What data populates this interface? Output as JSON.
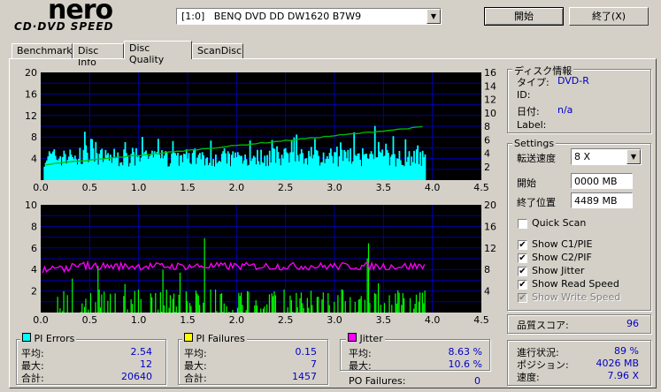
{
  "logo": {
    "line1": "nero",
    "line2": "CD·DVD SPEED"
  },
  "drive_select": {
    "value": "[1:0]   BENQ DVD DD DW1620 B7W9"
  },
  "buttons": {
    "start": "開始",
    "exit": "終了(X)"
  },
  "tabs": [
    {
      "label": "Benchmark"
    },
    {
      "label": "Disc Info"
    },
    {
      "label": "Disc Quality"
    },
    {
      "label": "ScanDisc"
    }
  ],
  "disc_info": {
    "title": "ディスク情報",
    "type_label": "タイプ:",
    "type_value": "DVD-R",
    "id_label": "ID:",
    "date_label": "日付:",
    "date_value": "n/a",
    "label_label": "Label:"
  },
  "settings": {
    "title": "Settings",
    "speed_label": "転送速度",
    "speed_value": "8 X",
    "start_label": "開始",
    "start_value": "0000 MB",
    "end_label": "終了位置",
    "end_value": "4489 MB",
    "quick_scan": "Quick Scan",
    "show_c1": "Show C1/PIE",
    "show_c2": "Show C2/PIF",
    "show_jitter": "Show Jitter",
    "show_read_speed": "Show Read Speed",
    "show_write_speed": "Show Write Speed"
  },
  "quality": {
    "label": "品質スコア:",
    "value": "96"
  },
  "progress": {
    "progress_label": "進行状況:",
    "progress_value": "89 %",
    "position_label": "ポジション:",
    "position_value": "4026 MB",
    "speed_label": "速度:",
    "speed_value": "7.96 X"
  },
  "pi_errors": {
    "title": "PI Errors",
    "avg_label": "平均:",
    "avg": "2.54",
    "max_label": "最大:",
    "max": "12",
    "total_label": "合計:",
    "total": "20640",
    "color": "#00ffff"
  },
  "pi_failures": {
    "title": "PI Failures",
    "avg_label": "平均:",
    "avg": "0.15",
    "max_label": "最大:",
    "max": "7",
    "total_label": "合計:",
    "total": "1457",
    "color": "#ffff00"
  },
  "jitter": {
    "title": "Jitter",
    "avg_label": "平均:",
    "avg": "8.63 %",
    "max_label": "最大:",
    "max": "10.6 %",
    "color": "#ff00ff"
  },
  "po_failures": {
    "label": "PO Failures:",
    "value": "0"
  },
  "chart_data": [
    {
      "type": "bar",
      "x_ticks": [
        "0.0",
        "0.5",
        "1.0",
        "1.5",
        "2.0",
        "2.5",
        "3.0",
        "3.5",
        "4.0",
        "4.5"
      ],
      "y_left_ticks": [
        "20",
        "16",
        "12",
        "8",
        "4"
      ],
      "y_right_ticks": [
        "16",
        "14",
        "12",
        "10",
        "8",
        "6",
        "4",
        "2"
      ],
      "xlim": [
        0,
        4.5
      ],
      "ylim_left": [
        0,
        20
      ],
      "ylim_right": [
        0,
        16
      ],
      "series": [
        {
          "color": "#00ffff",
          "baseline": 2.5,
          "max": 12,
          "x_end": 3.93
        },
        {
          "color": "#00c000",
          "line_start": [
            0.05,
            2.3
          ],
          "line_end": [
            3.9,
            7.9
          ],
          "axis": "right"
        }
      ]
    },
    {
      "type": "bar",
      "x_ticks": [
        "0.0",
        "0.5",
        "1.0",
        "1.5",
        "2.0",
        "2.5",
        "3.0",
        "3.5",
        "4.0",
        "4.5"
      ],
      "y_left_ticks": [
        "10",
        "8",
        "6",
        "4",
        "2"
      ],
      "y_right_ticks": [
        "20",
        "16",
        "12",
        "8",
        "4"
      ],
      "xlim": [
        0,
        4.5
      ],
      "ylim_left": [
        0,
        10
      ],
      "ylim_right": [
        0,
        20
      ],
      "series": [
        {
          "color": "#00ff00",
          "max": 7,
          "x_end": 3.93
        },
        {
          "color": "#ff00ff",
          "level": 8.6,
          "axis": "right",
          "x_end": 3.93
        }
      ]
    }
  ]
}
